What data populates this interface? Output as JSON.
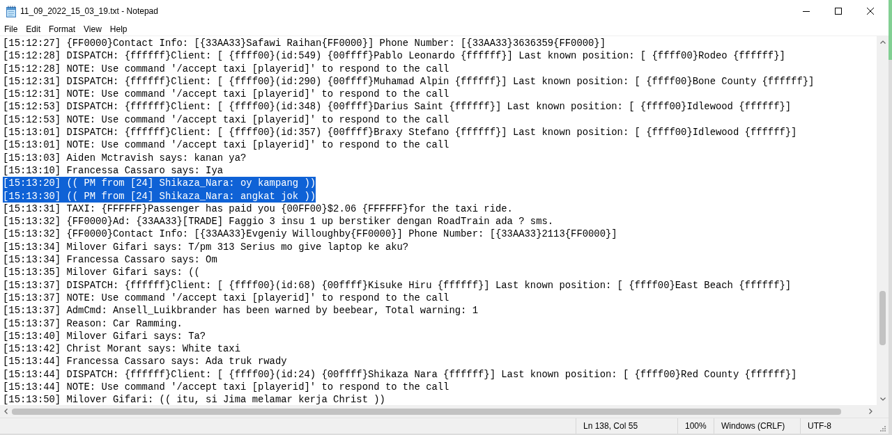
{
  "window": {
    "title": "11_09_2022_15_03_19.txt - Notepad"
  },
  "menu": [
    "File",
    "Edit",
    "Format",
    "View",
    "Help"
  ],
  "lines": [
    {
      "text": "[15:12:27] {FF0000}Contact Info: [{33AA33}Safawi Raihan{FF0000}] Phone Number: [{33AA33}3636359{FF0000}]",
      "selected": false
    },
    {
      "text": "[15:12:28] DISPATCH: {ffffff}Client: [ {ffff00}(id:549) {00ffff}Pablo Leonardo {ffffff}] Last known position: [ {ffff00}Rodeo {ffffff}]",
      "selected": false
    },
    {
      "text": "[15:12:28] NOTE: Use command '/accept taxi [playerid]' to respond to the call",
      "selected": false
    },
    {
      "text": "[15:12:31] DISPATCH: {ffffff}Client: [ {ffff00}(id:290) {00ffff}Muhamad Alpin {ffffff}] Last known position: [ {ffff00}Bone County {ffffff}]",
      "selected": false
    },
    {
      "text": "[15:12:31] NOTE: Use command '/accept taxi [playerid]' to respond to the call",
      "selected": false
    },
    {
      "text": "[15:12:53] DISPATCH: {ffffff}Client: [ {ffff00}(id:348) {00ffff}Darius Saint {ffffff}] Last known position: [ {ffff00}Idlewood {ffffff}]",
      "selected": false
    },
    {
      "text": "[15:12:53] NOTE: Use command '/accept taxi [playerid]' to respond to the call",
      "selected": false
    },
    {
      "text": "[15:13:01] DISPATCH: {ffffff}Client: [ {ffff00}(id:357) {00ffff}Braxy Stefano {ffffff}] Last known position: [ {ffff00}Idlewood {ffffff}]",
      "selected": false
    },
    {
      "text": "[15:13:01] NOTE: Use command '/accept taxi [playerid]' to respond to the call",
      "selected": false
    },
    {
      "text": "[15:13:03] Aiden Mctravish says: kanan ya?",
      "selected": false
    },
    {
      "text": "[15:13:10] Francessa Cassaro says: Iya",
      "selected": false
    },
    {
      "text": "[15:13:20] (( PM from [24] Shikaza_Nara: oy kampang ))",
      "selected": true
    },
    {
      "text": "[15:13:30] (( PM from [24] Shikaza_Nara: angkat jok ))",
      "selected": true
    },
    {
      "text": "[15:13:31] TAXI: {FFFFFF}Passenger has paid you {00FF00}$2.06 {FFFFFF}for the taxi ride.",
      "selected": false
    },
    {
      "text": "[15:13:32] {FF0000}Ad: {33AA33}[TRADE] Faggio 3 insu 1 up berstiker dengan RoadTrain ada ? sms.",
      "selected": false
    },
    {
      "text": "[15:13:32] {FF0000}Contact Info: [{33AA33}Evgeniy Willoughby{FF0000}] Phone Number: [{33AA33}2113{FF0000}]",
      "selected": false
    },
    {
      "text": "[15:13:34] Milover Gifari says: T/pm 313 Serius mo give laptop ke aku?",
      "selected": false
    },
    {
      "text": "[15:13:34] Francessa Cassaro says: Om",
      "selected": false
    },
    {
      "text": "[15:13:35] Milover Gifari says: ((",
      "selected": false
    },
    {
      "text": "[15:13:37] DISPATCH: {ffffff}Client: [ {ffff00}(id:68) {00ffff}Kisuke Hiru {ffffff}] Last known position: [ {ffff00}East Beach {ffffff}]",
      "selected": false
    },
    {
      "text": "[15:13:37] NOTE: Use command '/accept taxi [playerid]' to respond to the call",
      "selected": false
    },
    {
      "text": "[15:13:37] AdmCmd: Ansell_Luikbrander has been warned by beebear, Total warning: 1",
      "selected": false
    },
    {
      "text": "[15:13:37] Reason: Car Ramming.",
      "selected": false
    },
    {
      "text": "[15:13:40] Milover Gifari says: Ta?",
      "selected": false
    },
    {
      "text": "[15:13:42] Christ Morant says: White taxi",
      "selected": false
    },
    {
      "text": "[15:13:44] Francessa Cassaro says: Ada truk rwady",
      "selected": false
    },
    {
      "text": "[15:13:44] DISPATCH: {ffffff}Client: [ {ffff00}(id:24) {00ffff}Shikaza Nara {ffffff}] Last known position: [ {ffff00}Red County {ffffff}]",
      "selected": false
    },
    {
      "text": "[15:13:44] NOTE: Use command '/accept taxi [playerid]' to respond to the call",
      "selected": false
    },
    {
      "text": "[15:13:50] Milover Gifari: (( itu, si Jima melamar kerja Christ ))",
      "selected": false
    }
  ],
  "status_bar": {
    "position": "Ln 138, Col 55",
    "zoom": "100%",
    "line_ending": "Windows (CRLF)",
    "encoding": "UTF-8"
  }
}
